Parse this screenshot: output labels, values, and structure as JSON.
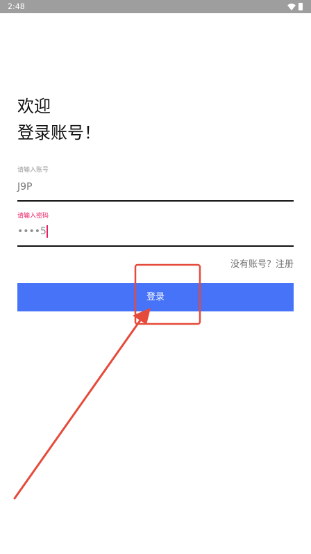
{
  "status_bar": {
    "time": "2:48",
    "icons": [
      "wifi-icon",
      "battery-icon"
    ]
  },
  "header": {
    "welcome": "欢迎",
    "subtitle": "登录账号！"
  },
  "form": {
    "account": {
      "label": "请输入账号",
      "value": "J9P"
    },
    "password": {
      "label": "请输入密码",
      "value": "••••5"
    },
    "register_link": "没有账号？注册",
    "login_button": "登录"
  },
  "colors": {
    "status_bar": "#9e9e9e",
    "primary_button": "#4673f7",
    "focus_accent": "#e91e63",
    "annotation": "#e64a3a"
  }
}
